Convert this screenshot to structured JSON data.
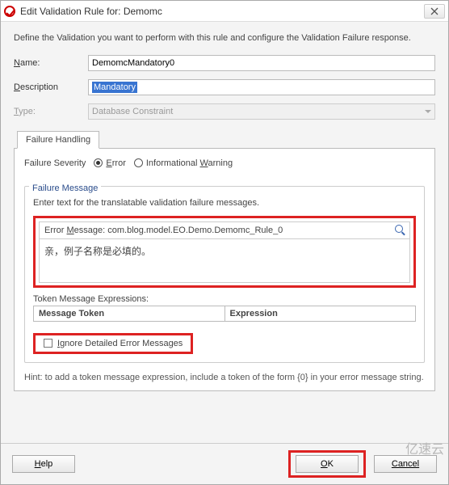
{
  "window": {
    "title": "Edit Validation Rule for: Demomc",
    "close_icon": "X"
  },
  "intro": "Define the Validation you want to perform with this rule and configure the Validation Failure response.",
  "fields": {
    "name_label": "Name:",
    "name_value": "DemomcMandatory0",
    "description_label": "Description",
    "description_value": "Mandatory",
    "type_label": "Type:",
    "type_value": "Database Constraint"
  },
  "tabs": {
    "failure_handling": "Failure Handling"
  },
  "severity": {
    "label": "Failure Severity",
    "options": {
      "error": "Error",
      "warning": "Informational Warning"
    },
    "selected": "error"
  },
  "failure_message": {
    "legend": "Failure Message",
    "hint": "Enter text for the translatable validation failure messages.",
    "error_header_label": "Error Message:",
    "error_header_value": "com.blog.model.EO.Demo.Demomc_Rule_0",
    "error_text": "亲，例子名称是必填的。",
    "token_label": "Token Message Expressions:",
    "token_col1": "Message Token",
    "token_col2": "Expression",
    "ignore_label": "Ignore Detailed Error Messages"
  },
  "bottom_hint": "Hint: to add a token message expression, include a token of the form {0} in your error message string.",
  "buttons": {
    "help": "Help",
    "ok": "OK",
    "cancel": "Cancel"
  },
  "watermark": "亿速云",
  "mnemonics": {
    "n": "N",
    "d": "D",
    "t": "T",
    "e": "E",
    "w": "W",
    "m": "M",
    "i": "I",
    "h": "H",
    "o": "O",
    "c": "C"
  }
}
